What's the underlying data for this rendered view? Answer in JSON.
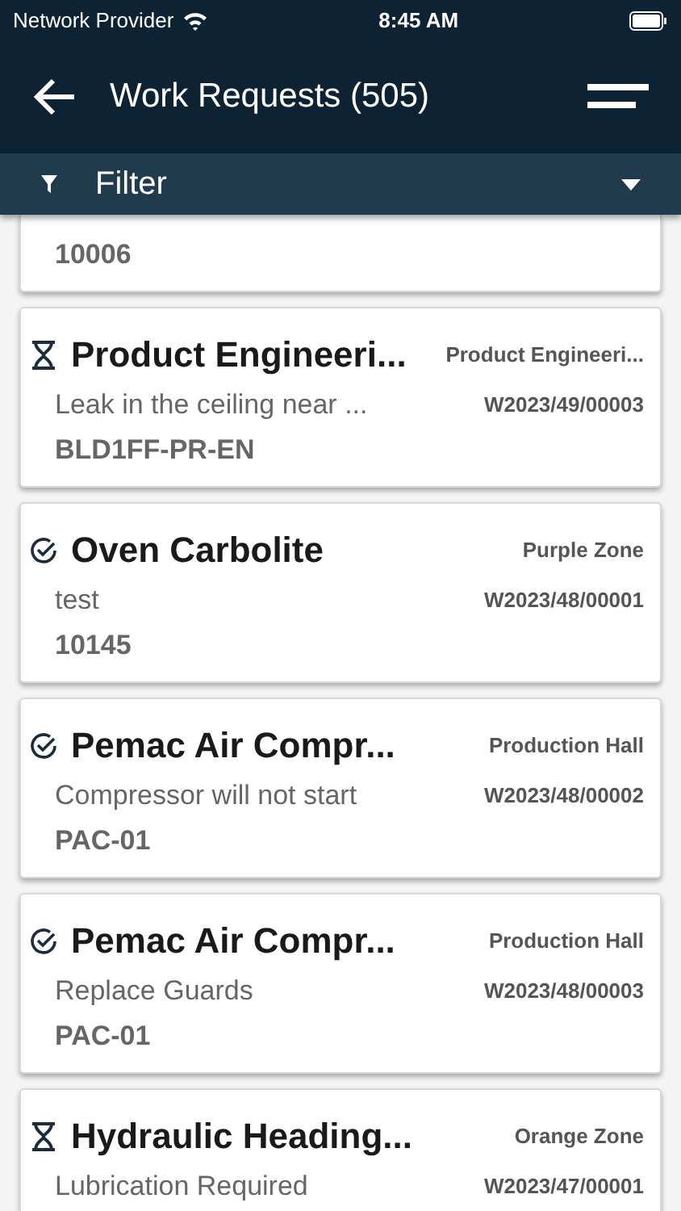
{
  "status_bar": {
    "carrier": "Network Provider",
    "time": "8:45 AM"
  },
  "header": {
    "title": "Work Requests (505)"
  },
  "filter": {
    "label": "Filter"
  },
  "partial_card": {
    "code": "10006"
  },
  "requests": [
    {
      "kind": "pending",
      "title": "Product Engineeri...",
      "zone": "Product Engineeri...",
      "description": "Leak in the ceiling near ...",
      "number": "W2023/49/00003",
      "code": "BLD1FF-PR-EN"
    },
    {
      "kind": "done",
      "title": "Oven Carbolite",
      "zone": "Purple Zone",
      "description": "test",
      "number": "W2023/48/00001",
      "code": "10145"
    },
    {
      "kind": "done",
      "title": "Pemac Air Compr...",
      "zone": "Production Hall",
      "description": "Compressor will not start",
      "number": "W2023/48/00002",
      "code": "PAC-01"
    },
    {
      "kind": "done",
      "title": "Pemac Air Compr...",
      "zone": "Production Hall",
      "description": "Replace Guards",
      "number": "W2023/48/00003",
      "code": "PAC-01"
    },
    {
      "kind": "pending",
      "title": "Hydraulic Heading...",
      "zone": "Orange Zone",
      "description": "Lubrication Required",
      "number": "W2023/47/00001"
    }
  ]
}
